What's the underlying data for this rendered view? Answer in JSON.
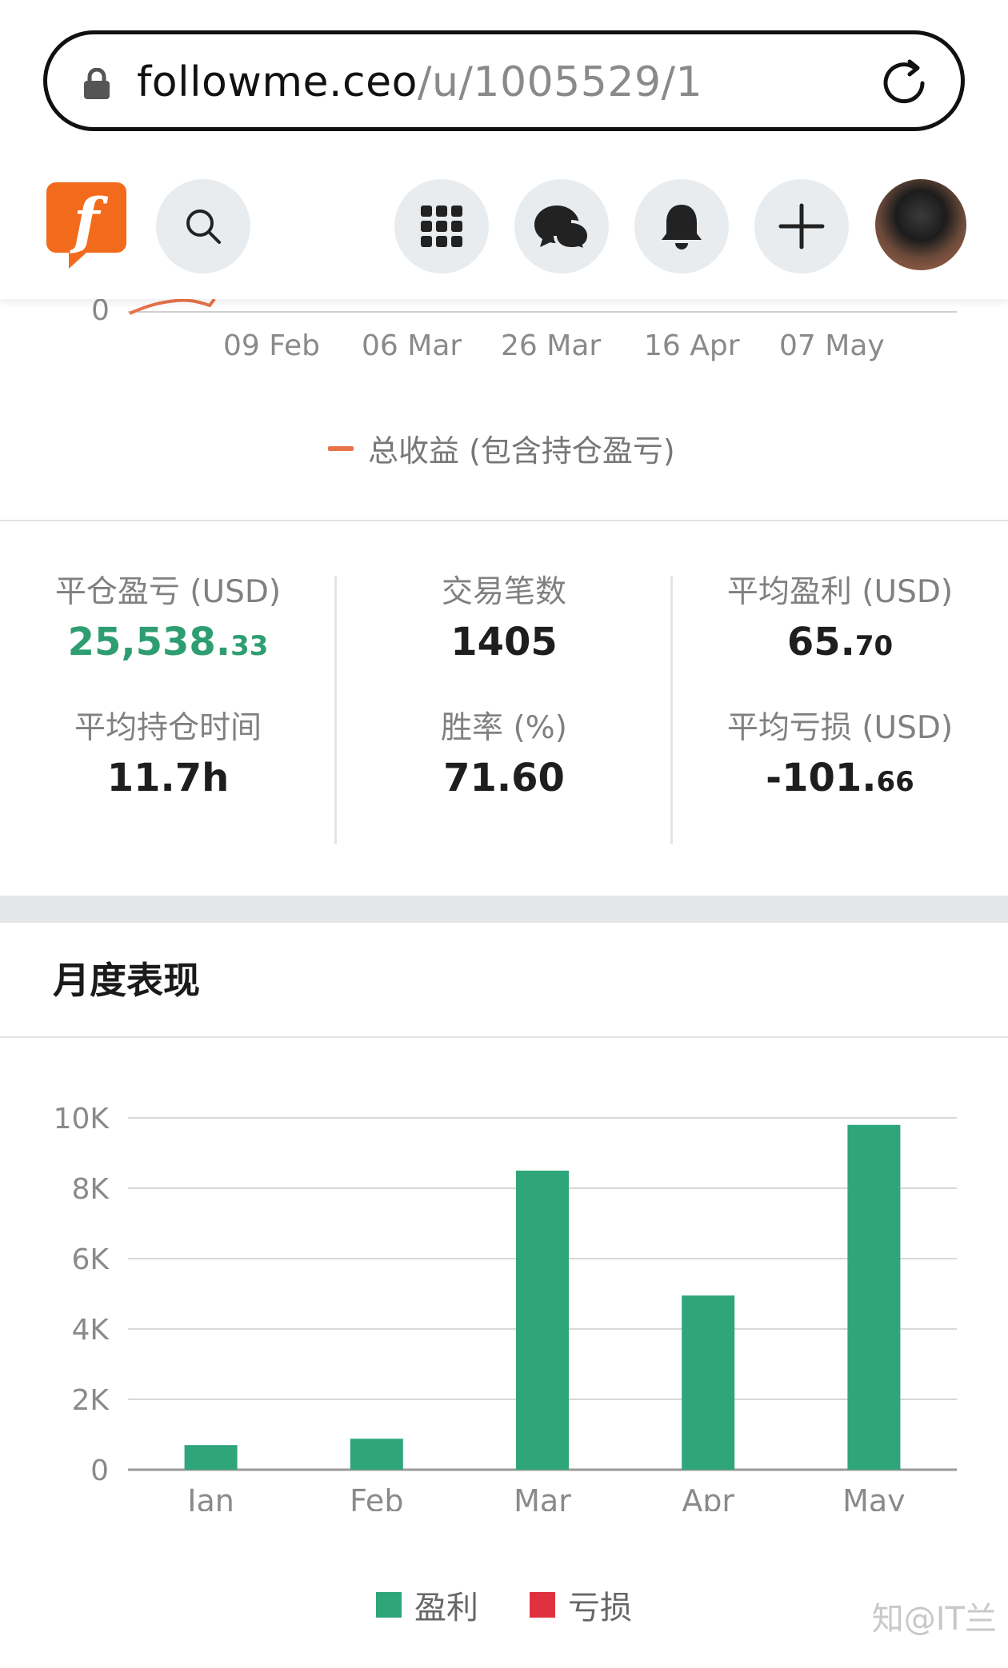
{
  "browser": {
    "url_host": "followme.ceo",
    "url_path": "/u/1005529/1"
  },
  "header": {
    "logo_letter": "f",
    "brand_color": "#f26b1d",
    "icons": [
      "search-icon",
      "apps-grid-icon",
      "chat-icon",
      "bell-icon",
      "plus-icon",
      "avatar"
    ]
  },
  "top_chart": {
    "y_tick": "0",
    "x_ticks": [
      "09 Feb",
      "06 Mar",
      "26 Mar",
      "16 Apr",
      "07 May"
    ],
    "legend": "总收益 (包含持仓盈亏)",
    "line_color": "#e8734a"
  },
  "stats": {
    "closed_pl_label": "平仓盈亏 (USD)",
    "closed_pl_int": "25,538.",
    "closed_pl_dec": "33",
    "trades_label": "交易笔数",
    "trades_value": "1405",
    "avg_profit_label": "平均盈利 (USD)",
    "avg_profit_int": "65.",
    "avg_profit_dec": "70",
    "avg_hold_label": "平均持仓时间",
    "avg_hold_value": "11.7h",
    "win_rate_label": "胜率 (%)",
    "win_rate_value": "71.60",
    "avg_loss_label": "平均亏损 (USD)",
    "avg_loss_int": "-101.",
    "avg_loss_dec": "66"
  },
  "monthly": {
    "title": "月度表现"
  },
  "chart_data": {
    "type": "bar",
    "categories": [
      "Jan",
      "Feb",
      "Mar",
      "Apr",
      "May"
    ],
    "series": [
      {
        "name": "盈利",
        "values": [
          700,
          880,
          8500,
          4950,
          9800
        ],
        "color": "#2fa57a"
      },
      {
        "name": "亏损",
        "values": [
          0,
          0,
          0,
          0,
          0
        ],
        "color": "#e0313f"
      }
    ],
    "y_ticks": [
      "0",
      "2K",
      "4K",
      "6K",
      "8K",
      "10K"
    ],
    "ylim": [
      0,
      10000
    ],
    "grid": true,
    "legend_position": "bottom"
  },
  "watermark": "知@IT兰"
}
